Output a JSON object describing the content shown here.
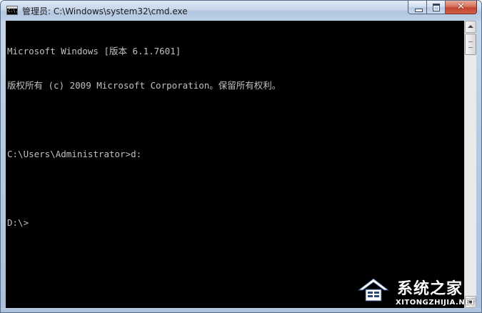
{
  "window": {
    "title": "管理员: C:\\Windows\\system32\\cmd.exe",
    "icon": "cmd-icon",
    "icon_text": "C:\\."
  },
  "caption_buttons": {
    "minimize_icon": "minimize-icon",
    "maximize_icon": "maximize-icon",
    "close_icon": "close-icon",
    "close_glyph": "✕"
  },
  "console": {
    "lines": [
      "Microsoft Windows [版本 6.1.7601]",
      "版权所有 (c) 2009 Microsoft Corporation。保留所有权利。",
      "",
      "C:\\Users\\Administrator>d:",
      "",
      "D:\\>"
    ]
  },
  "watermark": {
    "name": "系统之家",
    "url": "XITONGZHIJIA.NET"
  },
  "colors": {
    "console_bg": "#000000",
    "console_text": "#c0c0c0",
    "close_button": "#c2452e"
  }
}
